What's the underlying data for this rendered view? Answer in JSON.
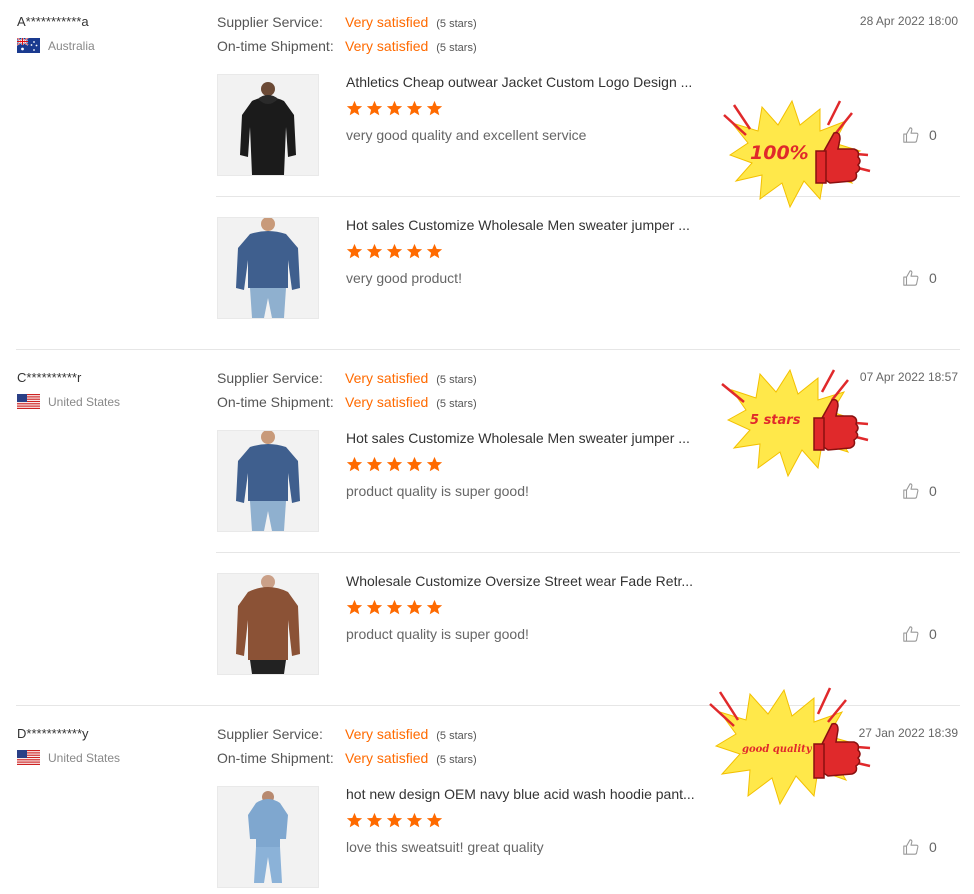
{
  "labels": {
    "supplier_service": "Supplier Service:",
    "ontime_shipment": "On-time Shipment:"
  },
  "colors": {
    "accent": "#ff6a00",
    "separator": "#e6e6e6",
    "sticker_yellow": "#ffe84a",
    "sticker_red": "#e0292b"
  },
  "reviews": [
    {
      "user": "A***********a",
      "country": "Australia",
      "flag_icon": "australia-flag-icon",
      "date": "28 Apr 2022 18:00",
      "supplier_service": "Very satisfied",
      "supplier_service_stars": "(5 stars)",
      "ontime_shipment": "Very satisfied",
      "ontime_shipment_stars": "(5 stars)",
      "sticker_text": "100%",
      "products": [
        {
          "title": "Athletics Cheap outwear Jacket Custom Logo Design ...",
          "rating": 5,
          "comment": "very good quality and excellent service",
          "likes": "0",
          "image": "black-hoodie"
        },
        {
          "title": "Hot sales Customize Wholesale Men sweater jumper ...",
          "rating": 5,
          "comment": "very good product!",
          "likes": "0",
          "image": "blue-sweatshirt"
        }
      ]
    },
    {
      "user": "C**********r",
      "country": "United States",
      "flag_icon": "us-flag-icon",
      "date": "07 Apr 2022 18:57",
      "supplier_service": "Very satisfied",
      "supplier_service_stars": "(5 stars)",
      "ontime_shipment": "Very satisfied",
      "ontime_shipment_stars": "(5 stars)",
      "sticker_text": "5 stars",
      "products": [
        {
          "title": "Hot sales Customize Wholesale Men sweater jumper ...",
          "rating": 5,
          "comment": "product quality is super good!",
          "likes": "0",
          "image": "blue-sweatshirt"
        },
        {
          "title": "Wholesale Customize Oversize Street wear Fade Retr...",
          "rating": 5,
          "comment": "product quality is super good!",
          "likes": "0",
          "image": "brown-hoodie"
        }
      ]
    },
    {
      "user": "D***********y",
      "country": "United States",
      "flag_icon": "us-flag-icon",
      "date": "27 Jan 2022 18:39",
      "supplier_service": "Very satisfied",
      "supplier_service_stars": "(5 stars)",
      "ontime_shipment": "Very satisfied",
      "ontime_shipment_stars": "(5 stars)",
      "sticker_text": "good quality",
      "products": [
        {
          "title": "hot new design OEM navy blue acid wash hoodie pant...",
          "rating": 5,
          "comment": "love this sweatsuit! great quality",
          "likes": "0",
          "image": "light-blue-sweatsuit"
        }
      ]
    }
  ]
}
